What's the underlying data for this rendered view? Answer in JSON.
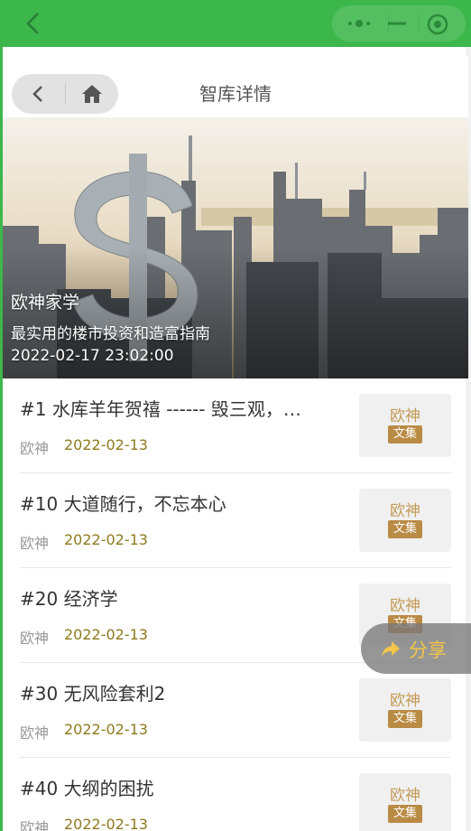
{
  "topbar": {
    "back_icon": "chevron-left-icon",
    "menu_icon": "more-dots-icon",
    "minimize_icon": "minus-icon",
    "close_icon": "target-icon"
  },
  "header": {
    "title": "智库详情",
    "back_icon": "chevron-left-icon",
    "home_icon": "home-icon"
  },
  "banner": {
    "line1": "欧神家学",
    "line2": "最实用的楼市投资和造富指南",
    "line3": "2022-02-17 23:02:00"
  },
  "thumbnail": {
    "top_text": "欧神",
    "box_text": "文集"
  },
  "articles": [
    {
      "title": "#1 水库羊年贺禧 ------ 毁三观，…",
      "author": "欧神",
      "date": "2022-02-13"
    },
    {
      "title": "#10 大道随行，不忘本心",
      "author": "欧神",
      "date": "2022-02-13"
    },
    {
      "title": "#20 经济学",
      "author": "欧神",
      "date": "2022-02-13"
    },
    {
      "title": "#30 无风险套利2",
      "author": "欧神",
      "date": "2022-02-13"
    },
    {
      "title": "#40 大纲的困扰",
      "author": "欧神",
      "date": "2022-02-13"
    }
  ],
  "share": {
    "label": "分享",
    "icon": "share-arrow-icon"
  },
  "colors": {
    "topbar": "#3cb74b",
    "date": "#8d7a1d",
    "share_label": "#f3c54a",
    "thumb_gold": "#b98b45"
  }
}
